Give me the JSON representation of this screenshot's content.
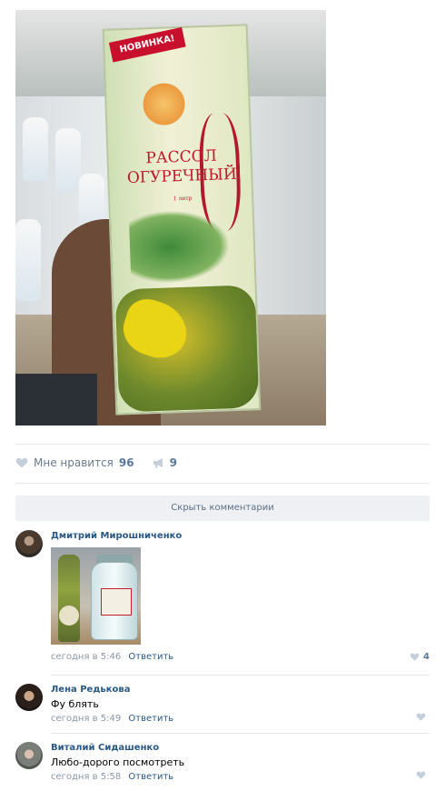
{
  "post": {
    "product_badge": "НОВИНКА!",
    "product_title_line1": "РАССОЛ",
    "product_title_line2": "ОГУРЕЧНЫЙ",
    "product_volume": "1 литр",
    "like_label": "Мне нравится",
    "like_count": "96",
    "share_count": "9"
  },
  "comments_toggle": {
    "label": "Скрыть комментарии"
  },
  "comments": [
    {
      "author": "Дмитрий Мирошниченко",
      "text": "",
      "time": "сегодня в 5:46",
      "reply": "Ответить",
      "likes": "4",
      "avatar_color": "#5a4b3c"
    },
    {
      "author": "Лена Редькова",
      "text": "Фу блять",
      "time": "сегодня в 5:49",
      "reply": "Ответить",
      "likes": "",
      "avatar_color": "#3a2a24"
    },
    {
      "author": "Виталий Сидашенко",
      "text": "Любо-дорого посмотреть",
      "time": "сегодня в 5:58",
      "reply": "Ответить",
      "likes": "",
      "avatar_color": "#6b6e6a"
    }
  ],
  "colors": {
    "link": "#2a5885",
    "meta": "#8a96a3",
    "like": "#5b7899",
    "toggle_bg": "#eef0f3"
  }
}
